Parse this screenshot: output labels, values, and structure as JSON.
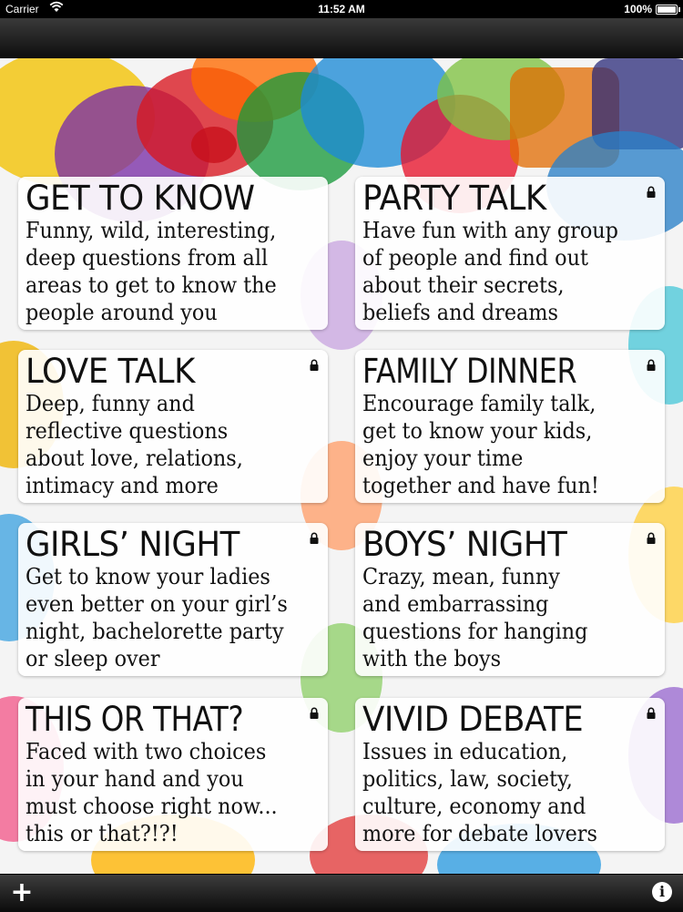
{
  "status_bar": {
    "carrier": "Carrier",
    "time": "11:52 AM",
    "battery": "100%"
  },
  "cards": [
    {
      "title": "GET TO KNOW",
      "desc": [
        "Funny, wild, interesting,",
        "deep questions from all",
        "areas to get to know the",
        "people around you"
      ],
      "locked": false
    },
    {
      "title": "PARTY TALK",
      "desc": [
        "Have fun with any group",
        "of people and find out",
        "about their secrets,",
        "beliefs and dreams"
      ],
      "locked": true
    },
    {
      "title": "LOVE TALK",
      "desc": [
        "Deep, funny and",
        "reflective questions",
        "about love, relations,",
        "intimacy and more"
      ],
      "locked": true
    },
    {
      "title": "FAMILY DINNER",
      "desc": [
        "Encourage family talk,",
        "get to know your kids,",
        "enjoy your time",
        "together and have fun!"
      ],
      "locked": true
    },
    {
      "title": "GIRLS’ NIGHT",
      "desc": [
        "Get to know your ladies",
        "even better on your girl’s",
        "night, bachelorette party",
        "or sleep over"
      ],
      "locked": true
    },
    {
      "title": "BOYS’ NIGHT",
      "desc": [
        "Crazy, mean, funny",
        "and embarrassing",
        "questions for hanging",
        "with the boys"
      ],
      "locked": true
    },
    {
      "title": "THIS OR THAT?",
      "desc": [
        "Faced with two choices",
        "in your hand and you",
        "must choose right now...",
        "this or that?!?!"
      ],
      "locked": true
    },
    {
      "title": "VIVID DEBATE",
      "desc": [
        "Issues in education,",
        "politics, law, society,",
        "culture, economy and",
        "more for debate lovers"
      ],
      "locked": true
    }
  ],
  "toolbar": {
    "add_icon": "plus-icon",
    "add_glyph": "+",
    "info_icon": "info-icon",
    "info_glyph": "i"
  },
  "colors": {
    "accent_red": "#d11a2a",
    "accent_blue": "#1a7fd1",
    "accent_yellow": "#f5c400",
    "accent_green": "#3aa635",
    "accent_purple": "#6a2e9a"
  }
}
